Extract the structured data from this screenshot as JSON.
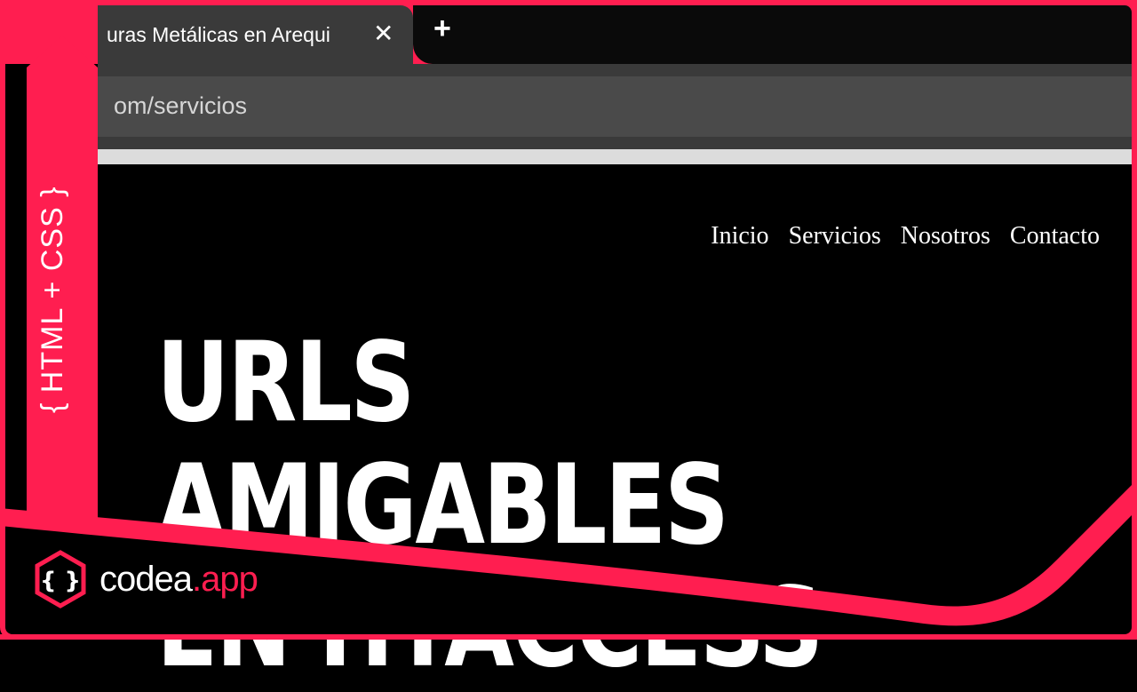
{
  "browser": {
    "tab_title": "uras Metálicas en Arequi",
    "tab_close_glyph": "✕",
    "new_tab_glyph": "+",
    "address_text": "om/servicios"
  },
  "page": {
    "nav": [
      "Inicio",
      "Servicios",
      "Nosotros",
      "Contacto"
    ]
  },
  "thumbnail": {
    "badge_text": "{ HTML + CSS }",
    "headline_line1": "URLS AMIGABLES",
    "headline_line2": "EN HTACCESS",
    "logo_brackets": "{ }",
    "logo_name": "codea",
    "logo_suffix": ".app"
  },
  "colors": {
    "accent": "#ff1e50",
    "background": "#000000",
    "chrome": "#3a3a3a"
  }
}
